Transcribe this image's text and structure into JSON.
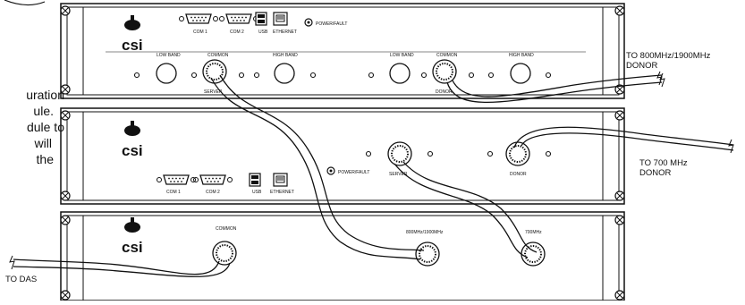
{
  "side_note": {
    "lines": [
      "uration",
      "ule.",
      "dule to",
      "will",
      "the"
    ]
  },
  "unit_top": {
    "logo_text": "csi",
    "ports_top": [
      "COM 1",
      "COM 2",
      "USB",
      "ETHERNET"
    ],
    "power_label": "POWER/FAULT",
    "band_labels": [
      "LOW BAND",
      "COMMON",
      "HIGH BAND",
      "LOW BAND",
      "COMMON",
      "HIGH BAND"
    ],
    "sub_labels": [
      "SERVER",
      "DONOR"
    ]
  },
  "unit_middle": {
    "logo_text": "csi",
    "ports_bottom": [
      "COM 1",
      "COM 2",
      "USB",
      "ETHERNET"
    ],
    "power_label": "POWER/FAULT",
    "server_label": "SERVER",
    "donor_label": "DONOR"
  },
  "unit_bottom": {
    "logo_text": "csi",
    "common_label": "COMMON",
    "port_labels": [
      "800MHz/1900MHz",
      "700MHz"
    ]
  },
  "callouts": {
    "to_800": [
      "TO 800MHz/1900MHz",
      "DONOR"
    ],
    "to_700": [
      "TO 700 MHz",
      "DONOR"
    ],
    "to_das": "TO DAS"
  },
  "colors": {
    "line": "#111111",
    "panel": "#ffffff"
  }
}
